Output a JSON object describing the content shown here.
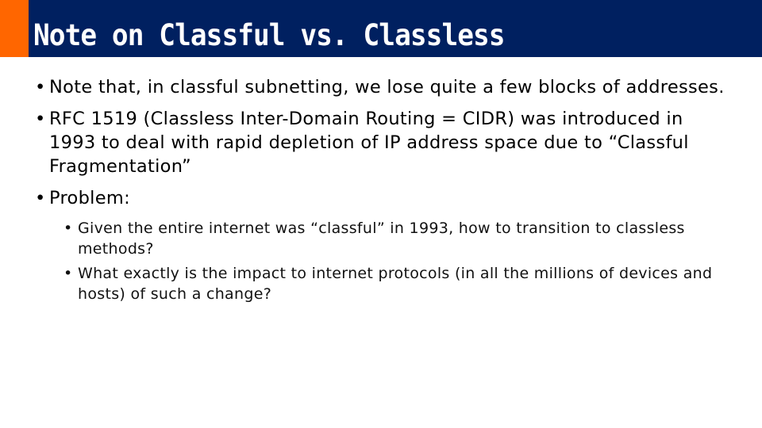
{
  "slide": {
    "title": "Note on Classful vs. Classless",
    "colors": {
      "header_bg": "#002060",
      "accent": "#ff6600",
      "title_text": "#ffffff",
      "body_text": "#000000"
    },
    "bullet_glyph": "•",
    "bullets": [
      {
        "text": "Note that, in classful subnetting, we lose quite a few blocks of addresses."
      },
      {
        "text": "RFC 1519 (Classless Inter-Domain Routing = CIDR) was introduced in 1993 to deal with rapid depletion of IP address space due to “Classful Fragmentation”"
      },
      {
        "text": "Problem:",
        "sub_bullets": [
          "Given the entire internet was “classful” in 1993, how to transition to classless methods?",
          "What exactly is the impact to internet protocols (in all the millions of devices and hosts) of such a change?"
        ]
      }
    ]
  }
}
